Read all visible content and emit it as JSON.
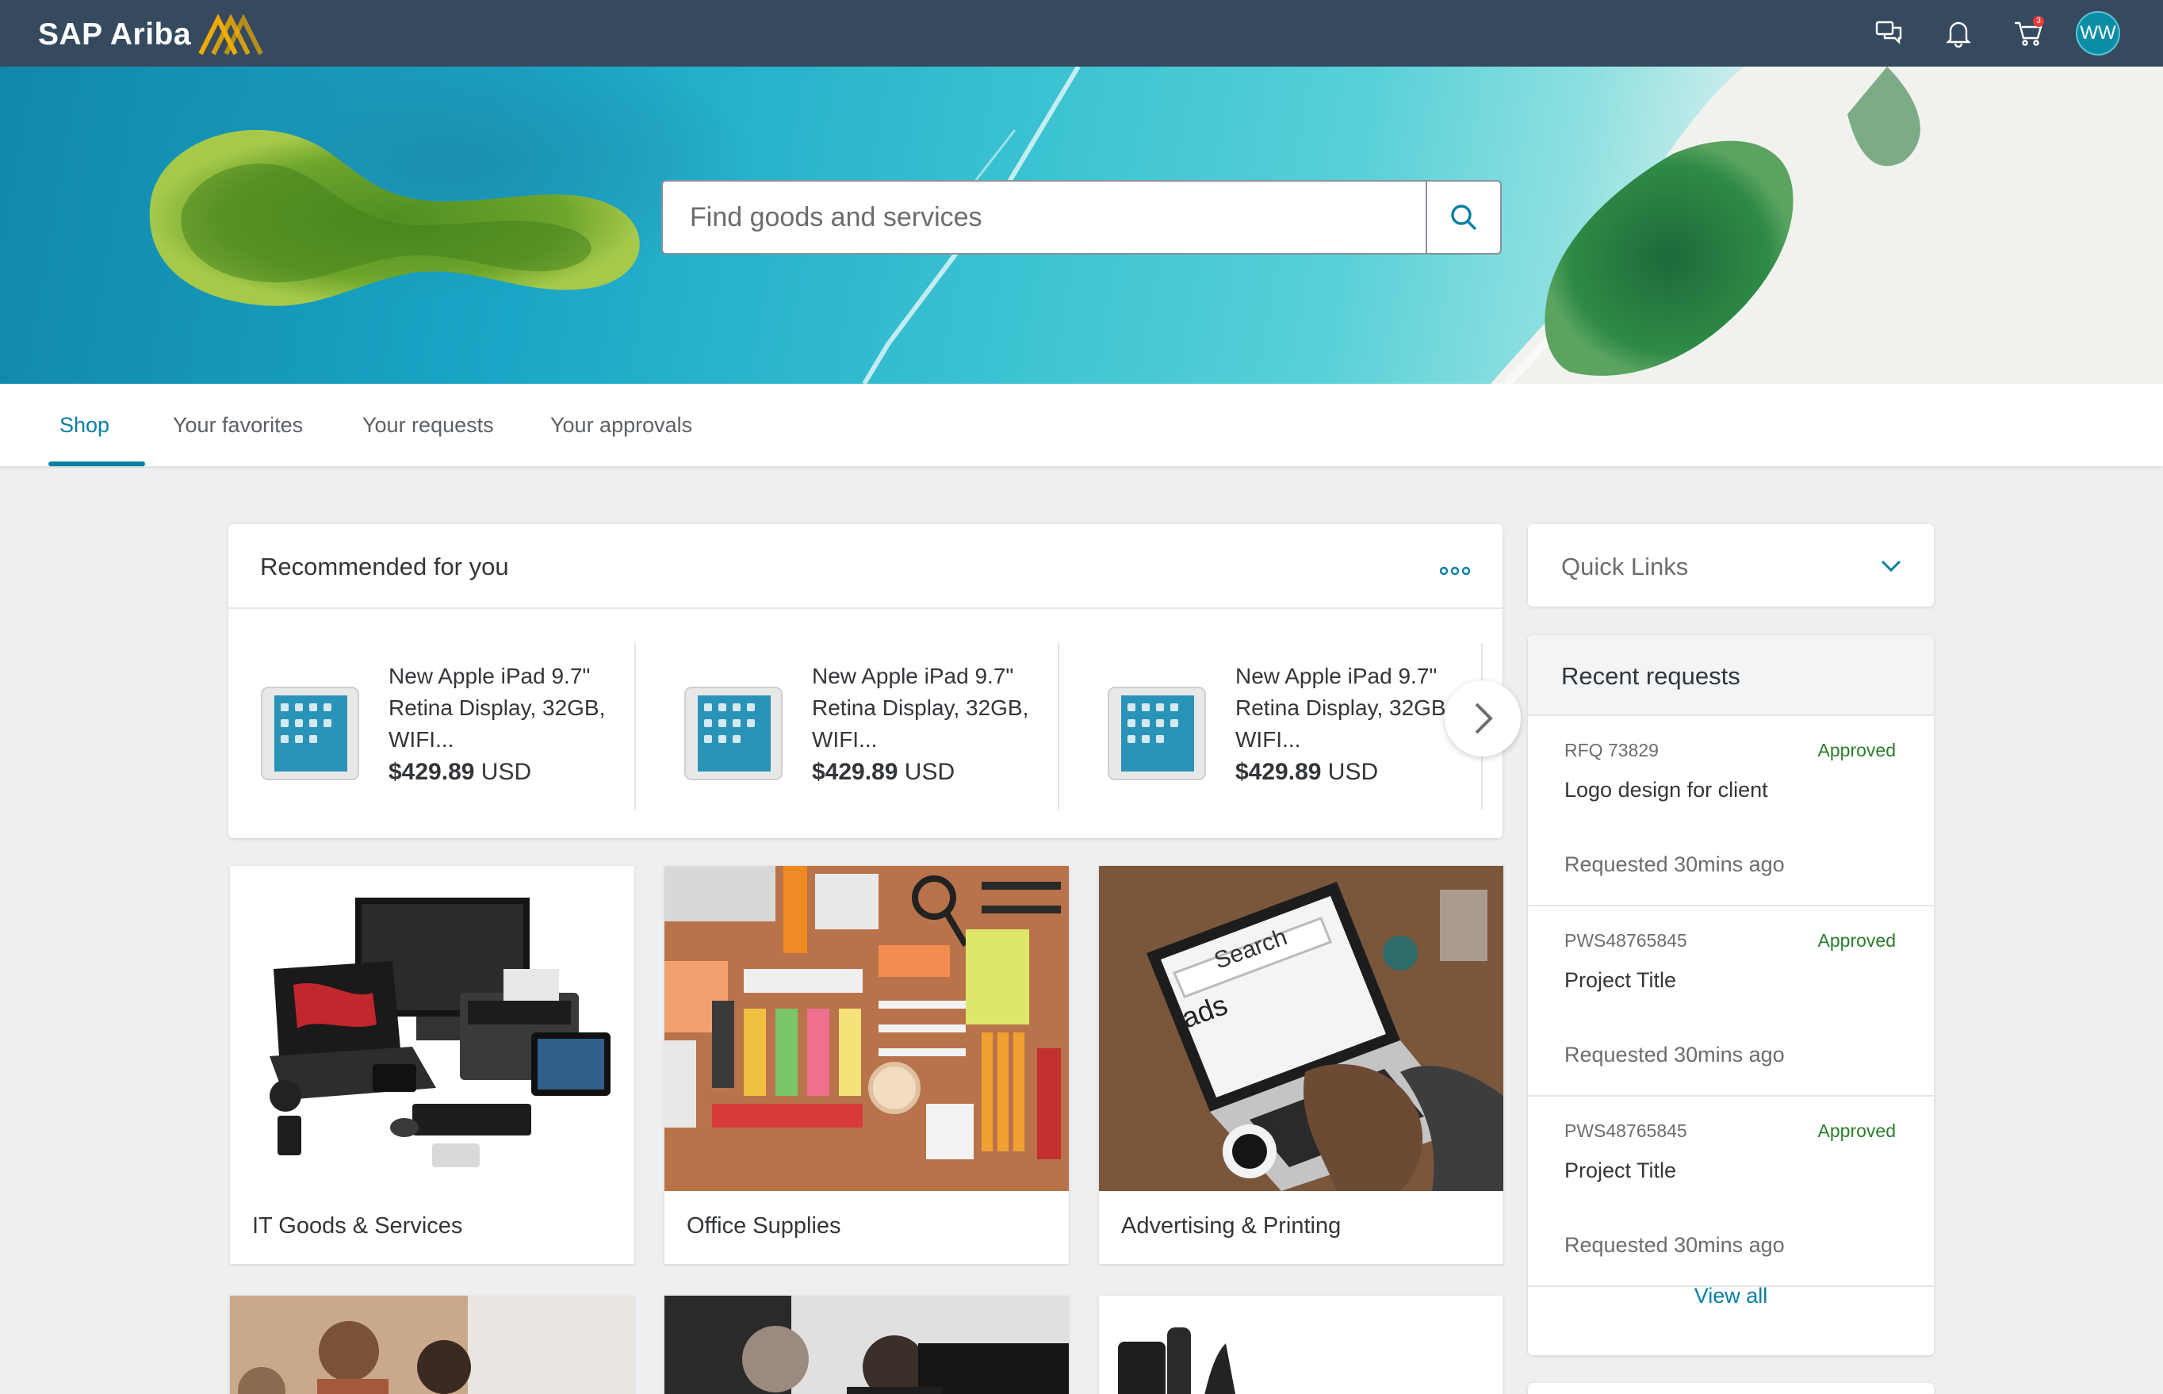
{
  "app": {
    "brand": "SAP Ariba"
  },
  "header": {
    "icons": [
      "chat-icon",
      "notification-bell-icon",
      "cart-icon"
    ],
    "cart_count": "3",
    "user_initials": "WW"
  },
  "search": {
    "placeholder": "Find goods and services",
    "value": ""
  },
  "tabs": [
    {
      "label": "Shop",
      "active": true
    },
    {
      "label": "Your favorites",
      "active": false
    },
    {
      "label": "Your requests",
      "active": false
    },
    {
      "label": "Your approvals",
      "active": false
    }
  ],
  "recommended": {
    "title": "Recommended for you",
    "products": [
      {
        "name": "New Apple iPad 9.7\" Retina Display, 32GB, WIFI...",
        "price_amount": "$429.89",
        "currency": "USD"
      },
      {
        "name": "New Apple iPad 9.7\" Retina Display, 32GB, WIFI...",
        "price_amount": "$429.89",
        "currency": "USD"
      },
      {
        "name": "New Apple iPad 9.7\" Retina Display, 32GB, WIFI...",
        "price_amount": "$429.89",
        "currency": "USD"
      }
    ]
  },
  "categories": [
    {
      "label": "IT Goods & Services"
    },
    {
      "label": "Office Supplies"
    },
    {
      "label": "Advertising & Printing"
    }
  ],
  "quick_links": {
    "title": "Quick Links"
  },
  "recent_requests": {
    "title": "Recent requests",
    "items": [
      {
        "id": "RFQ 73829",
        "status": "Approved",
        "name": "Logo design for client",
        "time": "Requested 30mins ago"
      },
      {
        "id": "PWS48765845",
        "status": "Approved",
        "name": "Project Title",
        "time": "Requested 30mins ago"
      },
      {
        "id": "PWS48765845",
        "status": "Approved",
        "name": "Project Title",
        "time": "Requested 30mins ago"
      }
    ],
    "view_all": "View all"
  },
  "colors": {
    "shell": "#354a5f",
    "accent": "#0a7ea4",
    "approved": "#2b7d2b",
    "logo_orange": "#f0ab00"
  }
}
